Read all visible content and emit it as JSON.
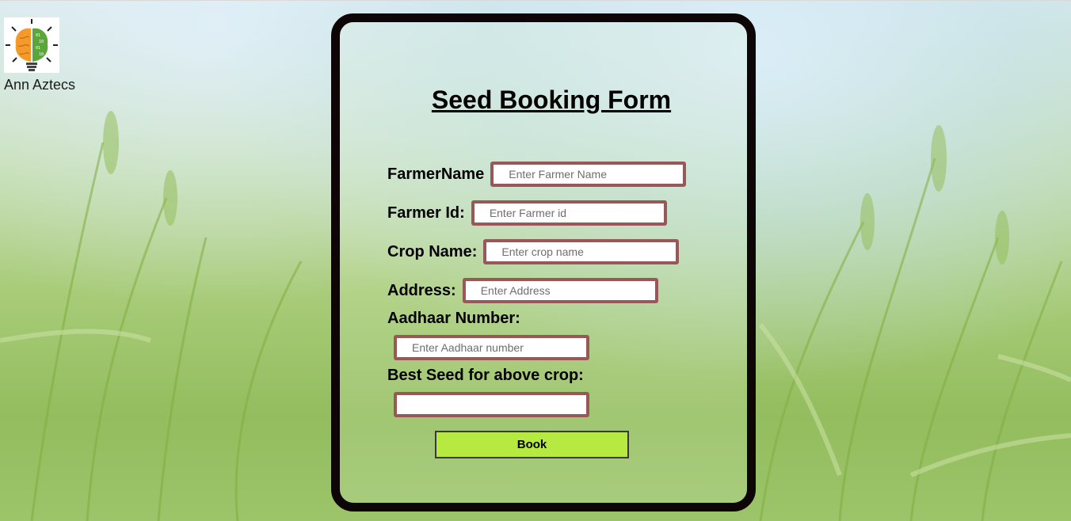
{
  "brand": {
    "name": "Ann Aztecs",
    "logo_icon": "brain-bulb-logo-icon"
  },
  "form": {
    "title": "Seed Booking Form",
    "fields": {
      "farmer_name": {
        "label": "FarmerName",
        "placeholder": "Enter Farmer Name",
        "value": ""
      },
      "farmer_id": {
        "label": "Farmer Id:",
        "placeholder": "Enter Farmer id",
        "value": ""
      },
      "crop_name": {
        "label": "Crop Name:",
        "placeholder": "Enter crop name",
        "value": ""
      },
      "address": {
        "label": "Address:",
        "placeholder": "Enter Address",
        "value": ""
      },
      "aadhaar": {
        "label": "Aadhaar Number:",
        "placeholder": "Enter Aadhaar number",
        "value": ""
      },
      "best_seed": {
        "label": "Best Seed for above crop:",
        "placeholder": "",
        "value": ""
      }
    },
    "submit_label": "Book"
  },
  "colors": {
    "card_border": "#0e0606",
    "field_border": "#9a5757",
    "button_bg": "#b7ea41"
  }
}
